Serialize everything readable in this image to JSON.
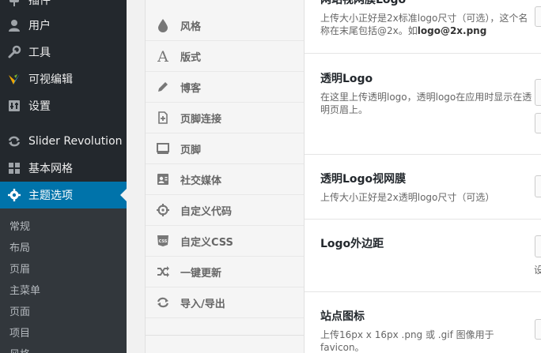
{
  "sidebar": {
    "menu": [
      {
        "label": "插件",
        "icon": "plugin-icon"
      },
      {
        "label": "用户",
        "icon": "user-icon"
      },
      {
        "label": "工具",
        "icon": "wrench-icon"
      },
      {
        "label": "可视编辑",
        "icon": "visual-composer-icon"
      },
      {
        "label": "设置",
        "icon": "settings-icon"
      },
      {
        "label": "Slider Revolution",
        "icon": "refresh-icon"
      },
      {
        "label": "基本网格",
        "icon": "grid-icon"
      },
      {
        "label": "主题选项",
        "icon": "gear-icon",
        "active": true
      }
    ],
    "submenu": [
      "常规",
      "布局",
      "页眉",
      "主菜单",
      "页面",
      "项目",
      "风格"
    ],
    "colors": {
      "bg": "#23282d",
      "active": "#0073aa",
      "submenu_bg": "#32373c"
    }
  },
  "tabs": [
    {
      "label": "风格",
      "icon": "drop-icon"
    },
    {
      "label": "版式",
      "icon": "typography-icon"
    },
    {
      "label": "博客",
      "icon": "pencil-icon"
    },
    {
      "label": "页脚连接",
      "icon": "add-page-icon"
    },
    {
      "label": "页脚",
      "icon": "monitor-icon"
    },
    {
      "label": "社交媒体",
      "icon": "contact-card-icon"
    },
    {
      "label": "自定义代码",
      "icon": "crosshair-icon"
    },
    {
      "label": "自定义CSS",
      "icon": "css-icon"
    },
    {
      "label": "一键更新",
      "icon": "shuffle-icon"
    },
    {
      "label": "导入/导出",
      "icon": "refresh-icon"
    }
  ],
  "fields": {
    "retina_logo": {
      "title": "网站视网膜Logo",
      "desc_text": "上传大小正好是2x标准logo尺寸（可选），这个名称在末尾包括@2x。如",
      "desc_bold": "logo@2x.png"
    },
    "transparent_logo": {
      "title": "透明Logo",
      "desc": "在这里上传透明logo，透明logo在应用时显示在透明页眉上。"
    },
    "transparent_retina_logo": {
      "title": "透明Logo视网膜",
      "desc": "上传大小正好是2x透明logo尺寸（可选）"
    },
    "logo_margin": {
      "title": "Logo外边距",
      "cut_text": "设"
    },
    "site_icon": {
      "title": "站点图标",
      "desc": "上传16px x 16px .png 或 .gif 图像用于favicon。"
    }
  }
}
